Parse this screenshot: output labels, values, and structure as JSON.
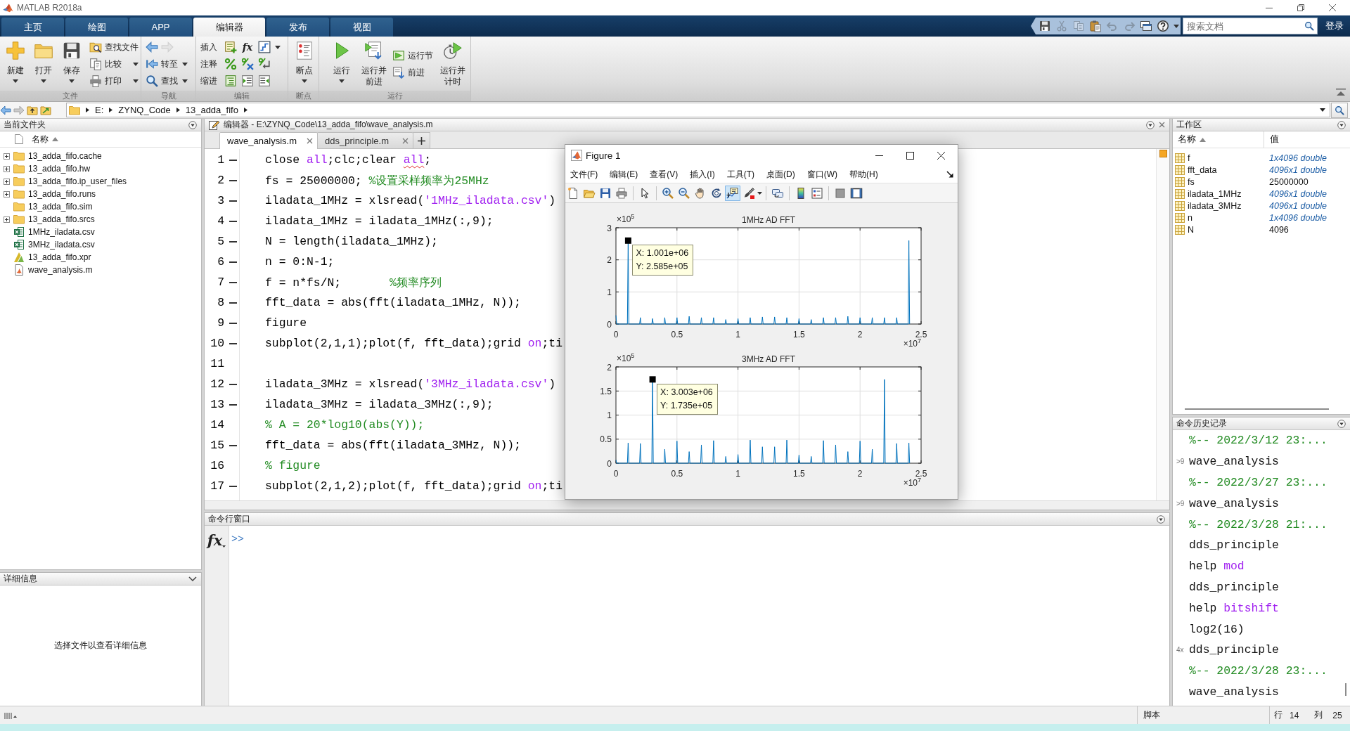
{
  "window": {
    "title": "MATLAB R2018a"
  },
  "ribbon_tabs": [
    {
      "label": "主页",
      "selected": false
    },
    {
      "label": "绘图",
      "selected": false
    },
    {
      "label": "APP",
      "selected": false
    },
    {
      "label": "编辑器",
      "selected": true
    },
    {
      "label": "发布",
      "selected": false
    },
    {
      "label": "视图",
      "selected": false
    }
  ],
  "quick_access": [
    {
      "disabled": false
    },
    {
      "disabled": true
    },
    {
      "disabled": true
    },
    {
      "disabled": false
    },
    {
      "disabled": true
    },
    {
      "disabled": true
    },
    {
      "disabled": false
    },
    {
      "disabled": false
    }
  ],
  "search": {
    "placeholder": "搜索文档"
  },
  "sign_in": "登录",
  "ribbon": {
    "groups": [
      {
        "label": "文件",
        "items": [
          {
            "kind": "large",
            "label": "新建",
            "dropdown": true
          },
          {
            "kind": "large",
            "label": "打开",
            "dropdown": true
          },
          {
            "kind": "large",
            "label": "保存",
            "dropdown": true
          },
          {
            "kind": "column",
            "rows": [
              {
                "label": "查找文件",
                "dropdown": false
              },
              {
                "label": "比较",
                "dropdown": true
              },
              {
                "label": "打印",
                "dropdown": true
              }
            ]
          }
        ]
      },
      {
        "label": "导航",
        "items": [
          {
            "kind": "column",
            "rows": [
              {
                "kind": "arrows",
                "back_disabled": false,
                "forward_disabled": true
              },
              {
                "label": "转至",
                "dropdown": true
              },
              {
                "label": "查找",
                "dropdown": true
              }
            ]
          }
        ]
      },
      {
        "label": "编辑",
        "items": [
          {
            "kind": "grid",
            "rows": [
              {
                "label": "插入",
                "fx": "fx",
                "dropdown": true
              },
              {
                "label": "注释",
                "dropdown": false
              },
              {
                "label": "缩进",
                "dropdown": false
              }
            ]
          }
        ]
      },
      {
        "label": "断点",
        "items": [
          {
            "kind": "large",
            "label": "断点",
            "dropdown": true
          }
        ]
      },
      {
        "label": "运行",
        "items": [
          {
            "kind": "large",
            "label": "运行",
            "dropdown": true
          },
          {
            "kind": "large",
            "label": "运行并前进",
            "dropdown": false
          },
          {
            "kind": "column",
            "rows": [
              {
                "label": "运行节",
                "dropdown": false
              },
              {
                "label": "前进",
                "dropdown": false
              }
            ]
          },
          {
            "kind": "large",
            "label": "运行并计时",
            "dropdown": false
          }
        ]
      }
    ]
  },
  "address_bar": {
    "back_disabled": false,
    "forward_disabled": true,
    "path": [
      "E:",
      "ZYNQ_Code",
      "13_adda_fifo"
    ]
  },
  "current_folder": {
    "title": "当前文件夹",
    "column": "名称",
    "files": [
      {
        "name": "13_adda_fifo.cache",
        "kind": "folder",
        "expandable": true
      },
      {
        "name": "13_adda_fifo.hw",
        "kind": "folder",
        "expandable": true
      },
      {
        "name": "13_adda_fifo.ip_user_files",
        "kind": "folder",
        "expandable": true
      },
      {
        "name": "13_adda_fifo.runs",
        "kind": "folder",
        "expandable": true
      },
      {
        "name": "13_adda_fifo.sim",
        "kind": "folder",
        "expandable": false
      },
      {
        "name": "13_adda_fifo.srcs",
        "kind": "folder",
        "expandable": true
      },
      {
        "name": "1MHz_iladata.csv",
        "kind": "spreadsheet",
        "expandable": false
      },
      {
        "name": "3MHz_iladata.csv",
        "kind": "spreadsheet",
        "expandable": false
      },
      {
        "name": "13_adda_fifo.xpr",
        "kind": "project",
        "expandable": false
      },
      {
        "name": "wave_analysis.m",
        "kind": "script",
        "expandable": false
      }
    ]
  },
  "details": {
    "title": "详细信息",
    "message": "选择文件以查看详细信息"
  },
  "editor": {
    "title": "编辑器 - E:\\ZYNQ_Code\\13_adda_fifo\\wave_analysis.m",
    "tabs": [
      {
        "label": "wave_analysis.m",
        "selected": true
      },
      {
        "label": "dds_principle.m",
        "selected": false
      }
    ],
    "lines": [
      {
        "number": "1",
        "executable": true,
        "tokens": [
          {
            "text": "close ",
            "kind": "code",
            "warning": false
          },
          {
            "text": "all",
            "kind": "string",
            "warning": false
          },
          {
            "text": ";clc;clear ",
            "kind": "code",
            "warning": false
          },
          {
            "text": "all",
            "kind": "string",
            "warning": true
          },
          {
            "text": ";",
            "kind": "code",
            "warning": false
          }
        ]
      },
      {
        "number": "2",
        "executable": true,
        "tokens": [
          {
            "text": "fs = 25000000; ",
            "kind": "code",
            "warning": false
          },
          {
            "text": "%设置采样频率为25MHz",
            "kind": "comment",
            "warning": false
          }
        ]
      },
      {
        "number": "3",
        "executable": true,
        "tokens": [
          {
            "text": "iladata_1MHz = xlsread(",
            "kind": "code",
            "warning": false
          },
          {
            "text": "'1MHz_iladata.csv'",
            "kind": "string",
            "warning": false
          },
          {
            "text": ")",
            "kind": "code",
            "warning": false
          }
        ]
      },
      {
        "number": "4",
        "executable": true,
        "tokens": [
          {
            "text": "iladata_1MHz = iladata_1MHz(:,9);",
            "kind": "code",
            "warning": false
          }
        ]
      },
      {
        "number": "5",
        "executable": true,
        "tokens": [
          {
            "text": "N = length(iladata_1MHz);",
            "kind": "code",
            "warning": false
          }
        ]
      },
      {
        "number": "6",
        "executable": true,
        "tokens": [
          {
            "text": "n = 0:N-1;",
            "kind": "code",
            "warning": false
          }
        ]
      },
      {
        "number": "7",
        "executable": true,
        "tokens": [
          {
            "text": "f = n*fs/N;       ",
            "kind": "code",
            "warning": false
          },
          {
            "text": "%频率序列",
            "kind": "comment",
            "warning": false
          }
        ]
      },
      {
        "number": "8",
        "executable": true,
        "tokens": [
          {
            "text": "fft_data = abs(fft(iladata_1MHz, N));",
            "kind": "code",
            "warning": false
          }
        ]
      },
      {
        "number": "9",
        "executable": true,
        "tokens": [
          {
            "text": "figure",
            "kind": "code",
            "warning": false
          }
        ]
      },
      {
        "number": "10",
        "executable": true,
        "tokens": [
          {
            "text": "subplot(2,1,1);plot(f, fft_data);grid ",
            "kind": "code",
            "warning": false
          },
          {
            "text": "on",
            "kind": "string",
            "warning": false
          },
          {
            "text": ";ti",
            "kind": "code",
            "warning": false
          }
        ]
      },
      {
        "number": "11",
        "executable": false
      },
      {
        "number": "12",
        "executable": true,
        "tokens": [
          {
            "text": "iladata_3MHz = xlsread(",
            "kind": "code",
            "warning": false
          },
          {
            "text": "'3MHz_iladata.csv'",
            "kind": "string",
            "warning": false
          },
          {
            "text": ")",
            "kind": "code",
            "warning": false
          }
        ]
      },
      {
        "number": "13",
        "executable": true,
        "tokens": [
          {
            "text": "iladata_3MHz = iladata_3MHz(:,9);",
            "kind": "code",
            "warning": false
          }
        ]
      },
      {
        "number": "14",
        "executable": false,
        "tokens": [
          {
            "text": "% A = 20*log10(abs(Y));",
            "kind": "comment",
            "warning": false
          }
        ]
      },
      {
        "number": "15",
        "executable": true,
        "tokens": [
          {
            "text": "fft_data = abs(fft(iladata_3MHz, N));",
            "kind": "code",
            "warning": false
          }
        ]
      },
      {
        "number": "16",
        "executable": false,
        "tokens": [
          {
            "text": "% figure",
            "kind": "comment",
            "warning": false
          }
        ]
      },
      {
        "number": "17",
        "executable": true,
        "tokens": [
          {
            "text": "subplot(2,1,2);plot(f, fft_data);grid ",
            "kind": "code",
            "warning": false
          },
          {
            "text": "on",
            "kind": "string",
            "warning": false
          },
          {
            "text": ";ti",
            "kind": "code",
            "warning": false
          }
        ]
      }
    ]
  },
  "command_window": {
    "title": "命令行窗口",
    "fx": "fx",
    "prompt": ">>"
  },
  "workspace": {
    "title": "工作区",
    "columns": [
      "名称",
      "值"
    ],
    "variables": [
      {
        "name": "f",
        "value": "1x4096 double",
        "kind": "array"
      },
      {
        "name": "fft_data",
        "value": "4096x1 double",
        "kind": "array"
      },
      {
        "name": "fs",
        "value": "25000000",
        "kind": "scalar"
      },
      {
        "name": "iladata_1MHz",
        "value": "4096x1 double",
        "kind": "array"
      },
      {
        "name": "iladata_3MHz",
        "value": "4096x1 double",
        "kind": "array"
      },
      {
        "name": "n",
        "value": "1x4096 double",
        "kind": "array"
      },
      {
        "name": "N",
        "value": "4096",
        "kind": "scalar"
      }
    ]
  },
  "command_history": {
    "title": "命令历史记录",
    "entries": [
      {
        "parts": [
          {
            "text": "%-- 2022/3/12 23:...",
            "kind": "comment"
          }
        ]
      },
      {
        "count": ">9",
        "parts": [
          {
            "text": "wave_analysis",
            "kind": "code"
          }
        ]
      },
      {
        "parts": [
          {
            "text": "%-- 2022/3/27 23:...",
            "kind": "comment"
          }
        ]
      },
      {
        "count": ">9",
        "parts": [
          {
            "text": "wave_analysis",
            "kind": "code"
          }
        ]
      },
      {
        "parts": [
          {
            "text": "%-- 2022/3/28 21:...",
            "kind": "comment"
          }
        ]
      },
      {
        "parts": [
          {
            "text": "dds_principle",
            "kind": "code"
          }
        ]
      },
      {
        "parts": [
          {
            "text": "help ",
            "kind": "code"
          },
          {
            "text": "mod",
            "kind": "string"
          }
        ]
      },
      {
        "parts": [
          {
            "text": "dds_principle",
            "kind": "code"
          }
        ]
      },
      {
        "parts": [
          {
            "text": "help ",
            "kind": "code"
          },
          {
            "text": "bitshift",
            "kind": "string"
          }
        ]
      },
      {
        "parts": [
          {
            "text": "log2(16)",
            "kind": "code"
          }
        ]
      },
      {
        "count": "4x",
        "parts": [
          {
            "text": "dds_principle",
            "kind": "code"
          }
        ]
      },
      {
        "parts": [
          {
            "text": "%-- 2022/3/28 23:...",
            "kind": "comment"
          }
        ]
      },
      {
        "parts": [
          {
            "text": "wave_analysis",
            "kind": "code"
          }
        ]
      }
    ]
  },
  "figure": {
    "title": "Figure 1",
    "menu": [
      "文件(F)",
      "编辑(E)",
      "查看(V)",
      "插入(I)",
      "工具(T)",
      "桌面(D)",
      "窗口(W)",
      "帮助(H)"
    ],
    "tools": [
      {
        "selected": false
      },
      {
        "selected": false
      },
      {
        "selected": false
      },
      {
        "selected": false
      },
      {
        "selected": false
      },
      {
        "selected": false
      },
      {
        "selected": false
      },
      {
        "selected": false
      },
      {
        "selected": false
      },
      {
        "selected": true
      },
      {
        "selected": false
      },
      {
        "selected": false
      },
      {
        "selected": false
      },
      {
        "selected": false
      },
      {
        "selected": false
      },
      {
        "selected": false
      }
    ],
    "chart_data": [
      {
        "type": "line",
        "title": "1MHz AD FFT",
        "grid": true,
        "color": "#0072bd",
        "xlim": [
          0,
          2.5
        ],
        "ylim": [
          0,
          3
        ],
        "xticks": [
          0,
          0.5,
          1,
          1.5,
          2,
          2.5
        ],
        "yticks": [
          0,
          1,
          2,
          3
        ],
        "annotations": [
          "×10$^{5}$",
          "×10$^{7}$",
          "X: 1.001e+06",
          "Y: 2.585e+05"
        ],
        "x": [
          0,
          0.006,
          0.094,
          0.1,
          0.106,
          0.194,
          0.2,
          0.206,
          0.294,
          0.3,
          0.306,
          0.394,
          0.4,
          0.406,
          0.494,
          0.5,
          0.506,
          0.594,
          0.6,
          0.606,
          0.694,
          0.7,
          0.706,
          0.794,
          0.8,
          0.806,
          0.894,
          0.9,
          0.906,
          0.994,
          1,
          1.006,
          1.094,
          1.1,
          1.106,
          1.194,
          1.2,
          1.206,
          1.294,
          1.3,
          1.306,
          1.394,
          1.4,
          1.406,
          1.494,
          1.5,
          1.506,
          1.594,
          1.6,
          1.606,
          1.694,
          1.7,
          1.706,
          1.794,
          1.8,
          1.806,
          1.894,
          1.9,
          1.906,
          1.994,
          2,
          2.006,
          2.094,
          2.1,
          2.106,
          2.194,
          2.2,
          2.206,
          2.294,
          2.3,
          2.306,
          2.394,
          2.4,
          2.406
        ],
        "values": [
          0.27,
          0,
          0,
          2.6,
          0,
          0,
          0.2,
          0,
          0,
          0.17,
          0,
          0,
          0.2,
          0,
          0,
          0.2,
          0,
          0,
          0.24,
          0,
          0,
          0.2,
          0,
          0,
          0.2,
          0,
          0,
          0.14,
          0,
          0,
          0.17,
          0,
          0,
          0.2,
          0,
          0,
          0.22,
          0,
          0,
          0.22,
          0,
          0,
          0.2,
          0,
          0,
          0.17,
          0,
          0,
          0.14,
          0,
          0,
          0.2,
          0,
          0,
          0.2,
          0,
          0,
          0.24,
          0,
          0,
          0.2,
          0,
          0,
          0.2,
          0,
          0,
          0.2,
          0,
          0,
          0.2,
          0,
          0,
          2.6,
          0
        ]
      },
      {
        "type": "line",
        "title": "3MHz AD FFT",
        "grid": true,
        "color": "#0072bd",
        "xlim": [
          0,
          2.5
        ],
        "ylim": [
          0,
          2
        ],
        "xticks": [
          0,
          0.5,
          1,
          1.5,
          2,
          2.5
        ],
        "yticks": [
          0,
          0.5,
          1,
          1.5,
          2
        ],
        "annotations": [
          "×10$^{5}$",
          "×10$^{7}$",
          "X: 3.003e+06",
          "Y: 1.735e+05"
        ],
        "x": [
          0,
          0.006,
          0.094,
          0.1,
          0.106,
          0.194,
          0.2,
          0.206,
          0.294,
          0.3,
          0.306,
          0.394,
          0.4,
          0.406,
          0.494,
          0.5,
          0.506,
          0.594,
          0.6,
          0.606,
          0.694,
          0.7,
          0.706,
          0.794,
          0.8,
          0.806,
          0.894,
          0.9,
          0.906,
          0.994,
          1,
          1.006,
          1.094,
          1.1,
          1.106,
          1.194,
          1.2,
          1.206,
          1.294,
          1.3,
          1.306,
          1.394,
          1.4,
          1.406,
          1.494,
          1.5,
          1.506,
          1.594,
          1.6,
          1.606,
          1.694,
          1.7,
          1.706,
          1.794,
          1.8,
          1.806,
          1.894,
          1.9,
          1.906,
          1.994,
          2,
          2.006,
          2.094,
          2.1,
          2.106,
          2.194,
          2.2,
          2.206,
          2.294,
          2.3,
          2.306,
          2.394,
          2.4,
          2.406
        ],
        "values": [
          0.07,
          0,
          0,
          0.42,
          0,
          0,
          0.41,
          0,
          0,
          1.74,
          0,
          0,
          0.29,
          0,
          0,
          0.46,
          0,
          0,
          0.24,
          0,
          0,
          0.38,
          0,
          0,
          0.47,
          0,
          0,
          0.14,
          0,
          0,
          0.18,
          0,
          0,
          0.48,
          0,
          0,
          0.34,
          0,
          0,
          0.34,
          0,
          0,
          0.48,
          0,
          0,
          0.17,
          0,
          0,
          0.14,
          0,
          0,
          0.47,
          0,
          0,
          0.38,
          0,
          0,
          0.24,
          0,
          0,
          0.46,
          0,
          0,
          0.29,
          0,
          0,
          1.74,
          0,
          0,
          0.41,
          0,
          0,
          0.42,
          0
        ]
      }
    ]
  },
  "status_bar": {
    "mode": "脚本",
    "line_label": "行",
    "line": "14",
    "column_label": "列",
    "column": "25"
  }
}
